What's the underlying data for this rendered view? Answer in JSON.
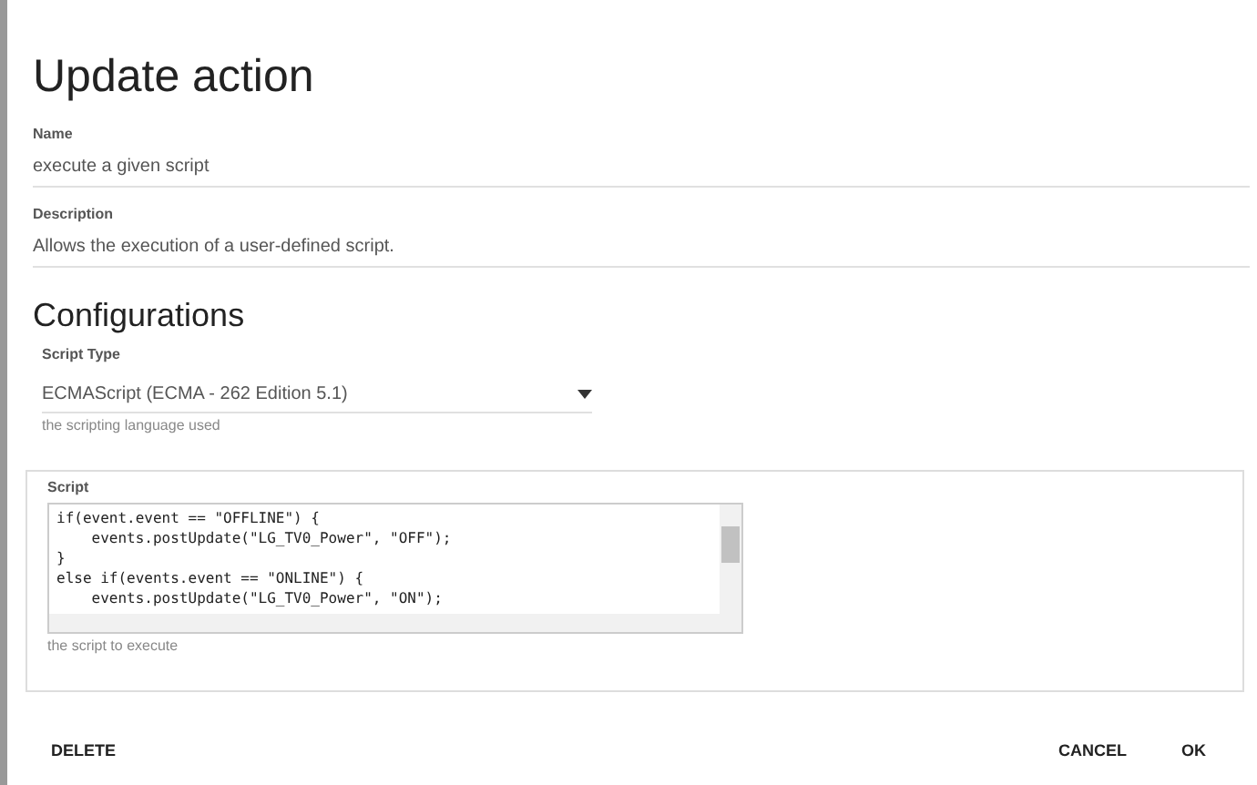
{
  "title": "Update action",
  "fields": [
    {
      "label": "Name",
      "value": "execute a given script"
    },
    {
      "label": "Description",
      "value": "Allows the execution of a user-defined script."
    }
  ],
  "configurations": {
    "heading": "Configurations",
    "script_type": {
      "label": "Script Type",
      "value": "ECMAScript (ECMA - 262 Edition 5.1)",
      "hint": "the scripting language used"
    },
    "script": {
      "label": "Script",
      "lines": [
        "if(event.event == \"OFFLINE\") {",
        "    events.postUpdate(\"LG_TV0_Power\", \"OFF\");",
        "}",
        "else if(events.event == \"ONLINE\") {",
        "    events.postUpdate(\"LG_TV0_Power\", \"ON\");"
      ],
      "hint": "the script to execute"
    }
  },
  "buttons": {
    "left": [
      "DELETE"
    ],
    "right": [
      "CANCEL",
      "OK"
    ]
  }
}
